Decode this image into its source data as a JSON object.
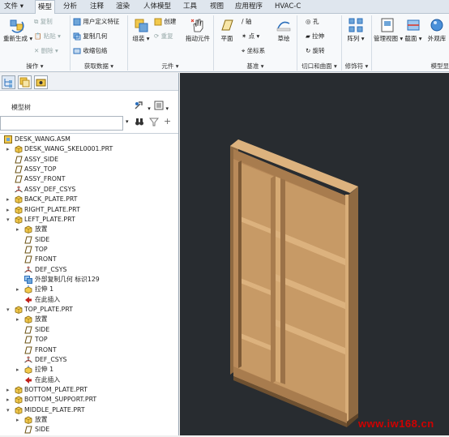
{
  "tabs": [
    "文件",
    "模型",
    "分析",
    "注释",
    "渲染",
    "人体模型",
    "工具",
    "视图",
    "应用程序",
    "HVAC-C"
  ],
  "active_tab": "模型",
  "ribbon": {
    "regen": "重新生成",
    "copy": "复制",
    "paste": "粘贴",
    "delete": "删除",
    "user_feature": "用户定义特征",
    "copy_geom": "复制几何",
    "shrinkwrap": "收缩包络",
    "assemble": "组装",
    "create": "创建",
    "repeat": "重复",
    "drag": "拖动元件",
    "plane": "平面",
    "axis": "轴",
    "point": "点",
    "csys": "坐标系",
    "sketch": "草绘",
    "hole": "孔",
    "extrude": "拉伸",
    "revolve": "旋转",
    "pattern": "阵列",
    "manage_view": "管理视图",
    "section": "截面",
    "appearance": "外观库",
    "groups": [
      "操作",
      "获取数据",
      "元件",
      "基准",
      "切口和曲面",
      "修饰符",
      "模型显"
    ]
  },
  "panel": {
    "title": "模型树"
  },
  "tree": [
    {
      "indent": 0,
      "exp": "",
      "icon": "assembly",
      "text": "DESK_WANG.ASM"
    },
    {
      "indent": 1,
      "exp": "▸",
      "icon": "part",
      "text": "DESK_WANG_SKEL0001.PRT"
    },
    {
      "indent": 1,
      "exp": "",
      "icon": "plane",
      "text": "ASSY_SIDE"
    },
    {
      "indent": 1,
      "exp": "",
      "icon": "plane",
      "text": "ASSY_TOP"
    },
    {
      "indent": 1,
      "exp": "",
      "icon": "plane",
      "text": "ASSY_FRONT"
    },
    {
      "indent": 1,
      "exp": "",
      "icon": "csys",
      "text": "ASSY_DEF_CSYS"
    },
    {
      "indent": 1,
      "exp": "▸",
      "icon": "part",
      "text": "BACK_PLATE.PRT"
    },
    {
      "indent": 1,
      "exp": "▸",
      "icon": "part",
      "text": "RIGHT_PLATE.PRT"
    },
    {
      "indent": 1,
      "exp": "▾",
      "icon": "part",
      "text": "LEFT_PLATE.PRT"
    },
    {
      "indent": 2,
      "exp": "▸",
      "icon": "part",
      "text": "放置"
    },
    {
      "indent": 2,
      "exp": "",
      "icon": "plane",
      "text": "SIDE"
    },
    {
      "indent": 2,
      "exp": "",
      "icon": "plane",
      "text": "TOP"
    },
    {
      "indent": 2,
      "exp": "",
      "icon": "plane",
      "text": "FRONT"
    },
    {
      "indent": 2,
      "exp": "",
      "icon": "csys",
      "text": "DEF_CSYS"
    },
    {
      "indent": 2,
      "exp": "",
      "icon": "copygeom",
      "text": "外部复制几何 标识129"
    },
    {
      "indent": 2,
      "exp": "▸",
      "icon": "extrude",
      "text": "拉伸 1"
    },
    {
      "indent": 2,
      "exp": "",
      "icon": "insert",
      "text": "在此插入"
    },
    {
      "indent": 1,
      "exp": "▾",
      "icon": "part",
      "text": "TOP_PLATE.PRT"
    },
    {
      "indent": 2,
      "exp": "▸",
      "icon": "part",
      "text": "放置"
    },
    {
      "indent": 2,
      "exp": "",
      "icon": "plane",
      "text": "SIDE"
    },
    {
      "indent": 2,
      "exp": "",
      "icon": "plane",
      "text": "TOP"
    },
    {
      "indent": 2,
      "exp": "",
      "icon": "plane",
      "text": "FRONT"
    },
    {
      "indent": 2,
      "exp": "",
      "icon": "csys",
      "text": "DEF_CSYS"
    },
    {
      "indent": 2,
      "exp": "▸",
      "icon": "extrude",
      "text": "拉伸 1"
    },
    {
      "indent": 2,
      "exp": "",
      "icon": "insert",
      "text": "在此插入"
    },
    {
      "indent": 1,
      "exp": "▸",
      "icon": "part",
      "text": "BOTTOM_PLATE.PRT"
    },
    {
      "indent": 1,
      "exp": "▸",
      "icon": "part",
      "text": "BOTTOM_SUPPORT.PRT"
    },
    {
      "indent": 1,
      "exp": "▾",
      "icon": "part",
      "text": "MIDDLE_PLATE.PRT"
    },
    {
      "indent": 2,
      "exp": "▸",
      "icon": "part",
      "text": "放置"
    },
    {
      "indent": 2,
      "exp": "",
      "icon": "plane",
      "text": "SIDE"
    }
  ],
  "watermark": "www.iw168.cn",
  "colors": {
    "viewport_bg": "#282c30",
    "wood_front": "#b98a5a",
    "wood_top": "#dcb27e",
    "wood_side": "#8f6a42",
    "accent": "#2a6ebb"
  }
}
